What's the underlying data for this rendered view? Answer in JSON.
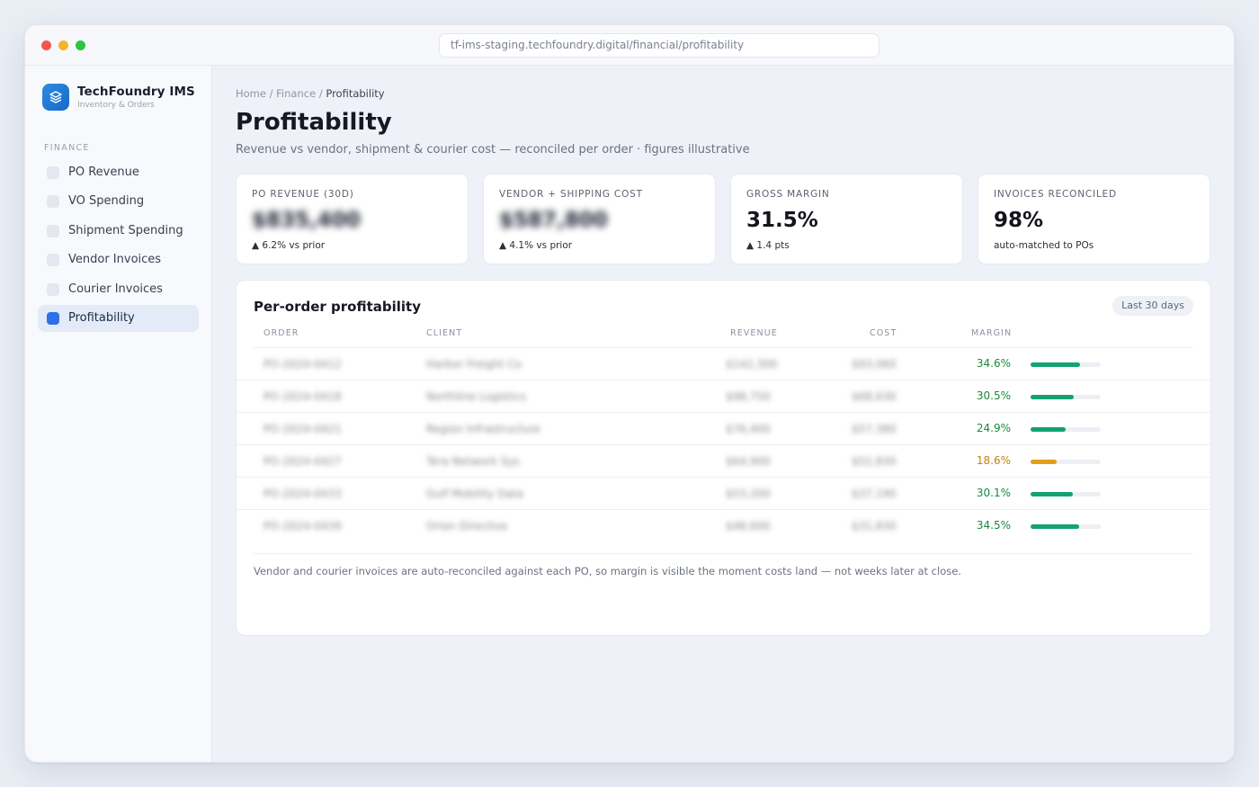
{
  "browser": {
    "url": "tf-ims-staging.techfoundry.digital/financial/profitability"
  },
  "sidebar": {
    "brand_name": "TechFoundry IMS",
    "brand_sub": "Inventory & Orders",
    "section": "FINANCE",
    "items": [
      {
        "label": "PO Revenue",
        "active": false
      },
      {
        "label": "VO Spending",
        "active": false
      },
      {
        "label": "Shipment Spending",
        "active": false
      },
      {
        "label": "Vendor Invoices",
        "active": false
      },
      {
        "label": "Courier Invoices",
        "active": false
      },
      {
        "label": "Profitability",
        "active": true
      }
    ]
  },
  "breadcrumb": {
    "home": "Home",
    "sep": "/",
    "finance": "Finance",
    "current": "Profitability"
  },
  "header": {
    "title": "Profitability",
    "subtitle": "Revenue vs vendor, shipment & courier cost — reconciled per order · figures illustrative"
  },
  "kpis": [
    {
      "label": "PO REVENUE (30D)",
      "value": "$835,400",
      "delta": "▲ 6.2% vs prior",
      "blurred": true
    },
    {
      "label": "VENDOR + SHIPPING COST",
      "value": "$587,800",
      "delta": "▲ 4.1% vs prior",
      "blurred": true
    },
    {
      "label": "GROSS MARGIN",
      "value": "31.5%",
      "delta": "▲ 1.4 pts",
      "blurred": false
    },
    {
      "label": "INVOICES RECONCILED",
      "value": "98%",
      "delta": "auto-matched to POs",
      "blurred": false
    }
  ],
  "table": {
    "title": "Per-order profitability",
    "range": "Last 30 days",
    "columns": {
      "order": "ORDER",
      "client": "CLIENT",
      "revenue": "REVENUE",
      "cost": "COST",
      "margin": "MARGIN"
    },
    "rows": [
      {
        "order": "PO-2024-0412",
        "client": "Harbor Freight Co",
        "revenue": "$142,300",
        "cost": "$93,060",
        "margin": "34.6%",
        "margin_fraction": 0.7,
        "color": "#13a272",
        "text_color": "#178a3c"
      },
      {
        "order": "PO-2024-0418",
        "client": "Northline Logistics",
        "revenue": "$98,750",
        "cost": "$68,630",
        "margin": "30.5%",
        "margin_fraction": 0.61,
        "color": "#13a272",
        "text_color": "#178a3c"
      },
      {
        "order": "PO-2024-0421",
        "client": "Region Infrastructure",
        "revenue": "$76,400",
        "cost": "$57,380",
        "margin": "24.9%",
        "margin_fraction": 0.5,
        "color": "#13a272",
        "text_color": "#178a3c"
      },
      {
        "order": "PO-2024-0427",
        "client": "Tera Network Sys",
        "revenue": "$64,900",
        "cost": "$52,830",
        "margin": "18.6%",
        "margin_fraction": 0.37,
        "color": "#e0a01a",
        "text_color": "#c4820e"
      },
      {
        "order": "PO-2024-0433",
        "client": "Gulf Mobility Data",
        "revenue": "$53,200",
        "cost": "$37,190",
        "margin": "30.1%",
        "margin_fraction": 0.6,
        "color": "#13a272",
        "text_color": "#178a3c"
      },
      {
        "order": "PO-2024-0439",
        "client": "Orion Directive",
        "revenue": "$48,600",
        "cost": "$31,830",
        "margin": "34.5%",
        "margin_fraction": 0.69,
        "color": "#13a272",
        "text_color": "#178a3c"
      }
    ],
    "footnote": "Vendor and courier invoices are auto-reconciled against each PO, so margin is visible the moment costs land — not weeks later at close."
  }
}
